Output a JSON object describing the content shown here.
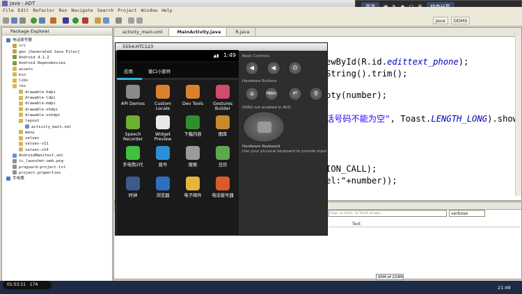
{
  "window": {
    "title": "Java - ADT"
  },
  "share_bar": {
    "btn1": "高清",
    "btn2": "结束分享"
  },
  "menu": [
    "File",
    "Edit",
    "Refactor",
    "Run",
    "Navigate",
    "Search",
    "Project",
    "Window",
    "Help"
  ],
  "perspectives": {
    "java": "Java",
    "ddms": "DDMS"
  },
  "package_explorer": {
    "title": "Package Explorer",
    "items": [
      {
        "label": "电话拨号器",
        "indent": 0,
        "color": "#4b77c4"
      },
      {
        "label": "src",
        "indent": 1,
        "color": "#c9a042"
      },
      {
        "label": "gen [Generated Java Files]",
        "indent": 1,
        "color": "#c9a042"
      },
      {
        "label": "Android 4.1.2",
        "indent": 1,
        "color": "#7c9a3e"
      },
      {
        "label": "Android Dependencies",
        "indent": 1,
        "color": "#7c9a3e"
      },
      {
        "label": "assets",
        "indent": 1,
        "color": "#d7b556"
      },
      {
        "label": "bin",
        "indent": 1,
        "color": "#d7b556"
      },
      {
        "label": "libs",
        "indent": 1,
        "color": "#d7b556"
      },
      {
        "label": "res",
        "indent": 1,
        "color": "#d7b556"
      },
      {
        "label": "drawable-hdpi",
        "indent": 2,
        "color": "#d7b556"
      },
      {
        "label": "drawable-ldpi",
        "indent": 2,
        "color": "#d7b556"
      },
      {
        "label": "drawable-mdpi",
        "indent": 2,
        "color": "#d7b556"
      },
      {
        "label": "drawable-xhdpi",
        "indent": 2,
        "color": "#d7b556"
      },
      {
        "label": "drawable-xxhdpi",
        "indent": 2,
        "color": "#d7b556"
      },
      {
        "label": "layout",
        "indent": 2,
        "color": "#d7b556"
      },
      {
        "label": "activity_main.xml",
        "indent": 3,
        "color": "#6a8fd1"
      },
      {
        "label": "menu",
        "indent": 2,
        "color": "#d7b556"
      },
      {
        "label": "values",
        "indent": 2,
        "color": "#d7b556"
      },
      {
        "label": "values-v11",
        "indent": 2,
        "color": "#d7b556"
      },
      {
        "label": "values-v14",
        "indent": 2,
        "color": "#d7b556"
      },
      {
        "label": "AndroidManifest.xml",
        "indent": 1,
        "color": "#6a8fd1"
      },
      {
        "label": "ic_launcher-web.png",
        "indent": 1,
        "color": "#8e8e8e"
      },
      {
        "label": "proguard-project.txt",
        "indent": 1,
        "color": "#8e8e8e"
      },
      {
        "label": "project.properties",
        "indent": 1,
        "color": "#8e8e8e"
      },
      {
        "label": "手电筒",
        "indent": 0,
        "color": "#4b77c4"
      }
    ]
  },
  "editor": {
    "tabs": [
      "activity_main.xml",
      "MainActivity.java",
      "R.java"
    ],
    "code": [
      {
        "pre": "ewById(R.id.",
        "em": "edittext_phone",
        "post": ");"
      },
      {
        "pre": "String().trim();",
        "em": "",
        "post": ""
      },
      {
        "pre": "pty(number);",
        "em": "",
        "post": ""
      },
      {
        "pre": "",
        "em": "",
        "post": ""
      },
      {
        "pre": "ION_CALL);",
        "em": "",
        "post": ""
      },
      {
        "pre": "el:\"+number));",
        "em": "",
        "post": ""
      }
    ],
    "toast_line": {
      "str": "话号码不能为空\"",
      "mid": ", Toast.",
      "em": "LENGTH_LONG",
      "post": ").show"
    }
  },
  "emulator": {
    "title": "5554:HTC123",
    "time": "1:49",
    "tabs": [
      "应用",
      "窗口小部件"
    ],
    "apps": [
      {
        "label": "API Demos",
        "color": "#8a8a8a"
      },
      {
        "label": "Custom Locale",
        "color": "#d9822b"
      },
      {
        "label": "Dev Tools",
        "color": "#d9822b"
      },
      {
        "label": "Gestures Builder",
        "color": "#d14b6a"
      },
      {
        "label": "Speech Recorder",
        "color": "#6bb02f"
      },
      {
        "label": "Widget Preview",
        "color": "#e8e8e8"
      },
      {
        "label": "下载内容",
        "color": "#2f8f2f"
      },
      {
        "label": "图库",
        "color": "#c78b2b"
      },
      {
        "label": "手电筒2代",
        "color": "#40c040"
      },
      {
        "label": "拨号",
        "color": "#2b8fd6"
      },
      {
        "label": "搜索",
        "color": "#9a9a9a"
      },
      {
        "label": "日历",
        "color": "#5da84e"
      },
      {
        "label": "时钟",
        "color": "#3c5a8a"
      },
      {
        "label": "浏览器",
        "color": "#2f6fc2"
      },
      {
        "label": "电子邮件",
        "color": "#e6b63a"
      },
      {
        "label": "电话拨号器",
        "color": "#d95b2b"
      }
    ],
    "controls": {
      "basic": "Basic Controls",
      "hardware": "Hardware Buttons",
      "dpad": "DPAD not enabled in AVD",
      "keyboard": "Hardware Keyboard",
      "keyboard_hint": "Use your physical keyboard to provide input",
      "menu": "MENU"
    }
  },
  "logcat": {
    "filter_placeholder": "tag: or text: to limit scope.",
    "level": "verbose",
    "col_text": "Text"
  },
  "status": {
    "recording": "01:53:11",
    "rec_extra": "174",
    "memory": "95M of 229M",
    "clock": "21:49"
  }
}
